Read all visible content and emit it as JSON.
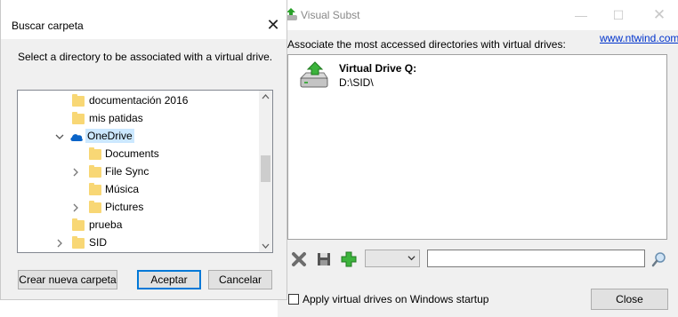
{
  "visual_subst": {
    "title": "Visual Subst",
    "window_controls": {
      "minimize": "—",
      "maximize": "☐",
      "close": "✕"
    },
    "website_link": "www.ntwind.com",
    "caption": "Associate the most accessed directories with virtual drives:",
    "drives": [
      {
        "name": "Virtual Drive Q:",
        "path": "D:\\SID\\",
        "icon": "virtual-drive-icon"
      }
    ],
    "toolbar": {
      "delete_icon": "delete-icon",
      "save_icon": "save-icon",
      "add_icon": "add-icon"
    },
    "drive_select_value": "",
    "path_input_value": "",
    "search_icon": "search-icon",
    "startup_checkbox_label": "Apply virtual drives on Windows startup",
    "startup_checked": false,
    "close_button": "Close"
  },
  "dialog": {
    "title": "Buscar carpeta",
    "close_glyph": "✕",
    "caption": "Select a directory to be associated with a virtual drive.",
    "tree": [
      {
        "label": "documentación 2016",
        "icon": "folder-icon",
        "level": 1,
        "chevron": ""
      },
      {
        "label": "mis patidas",
        "icon": "folder-icon",
        "level": 1,
        "chevron": ""
      },
      {
        "label": "OneDrive",
        "icon": "onedrive-cloud-icon",
        "level": 1,
        "chevron": "expanded",
        "selected": true
      },
      {
        "label": "Documents",
        "icon": "folder-icon",
        "level": 2,
        "chevron": ""
      },
      {
        "label": "File Sync",
        "icon": "folder-icon",
        "level": 2,
        "chevron": "collapsed"
      },
      {
        "label": "Música",
        "icon": "folder-icon",
        "level": 2,
        "chevron": ""
      },
      {
        "label": "Pictures",
        "icon": "folder-icon",
        "level": 2,
        "chevron": "collapsed"
      },
      {
        "label": "prueba",
        "icon": "folder-icon",
        "level": 1,
        "chevron": ""
      },
      {
        "label": "SID",
        "icon": "folder-icon",
        "level": 1,
        "chevron": "collapsed"
      }
    ],
    "buttons": {
      "new_folder": "Crear nueva carpeta",
      "ok": "Aceptar",
      "cancel": "Cancelar"
    }
  },
  "colors": {
    "accent": "#0078d7",
    "selection": "#cce8ff",
    "folder": "#f8d775",
    "link": "#0033cc"
  }
}
